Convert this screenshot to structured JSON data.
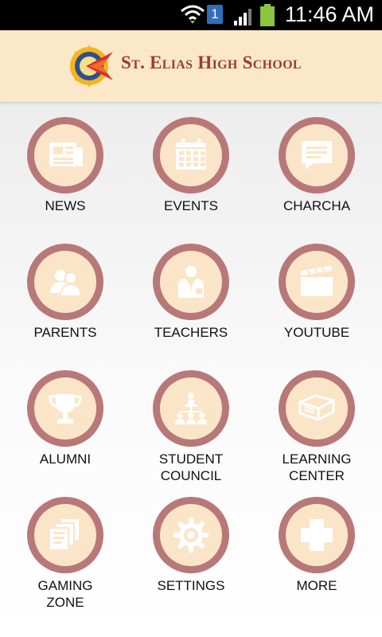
{
  "status_bar": {
    "time": "11:46 AM",
    "notification_count": "1",
    "icons": [
      "wifi-icon",
      "sim-icon",
      "signal-icon",
      "battery-icon"
    ]
  },
  "header": {
    "school_name": "St. Elias High School",
    "logo_name": "school-logo"
  },
  "colors": {
    "header_bg": "#fbe8c9",
    "ring": "#b87878",
    "inner": "#fbe5c8",
    "icon": "#ffffff",
    "title": "#9a3b34"
  },
  "menu": [
    {
      "label": "NEWS",
      "icon": "newspaper-icon"
    },
    {
      "label": "EVENTS",
      "icon": "calendar-icon"
    },
    {
      "label": "CHARCHA",
      "icon": "chat-icon"
    },
    {
      "label": "PARENTS",
      "icon": "parents-icon"
    },
    {
      "label": "TEACHERS",
      "icon": "teacher-icon"
    },
    {
      "label": "YOUTUBE",
      "icon": "clapperboard-icon"
    },
    {
      "label": "ALUMNI",
      "icon": "trophy-icon"
    },
    {
      "label": "STUDENT\nCOUNCIL",
      "icon": "council-icon"
    },
    {
      "label": "LEARNING\nCENTER",
      "icon": "book-icon"
    },
    {
      "label": "GAMING\nZONE",
      "icon": "documents-icon"
    },
    {
      "label": "SETTINGS",
      "icon": "gear-icon"
    },
    {
      "label": "MORE",
      "icon": "plus-icon"
    }
  ]
}
